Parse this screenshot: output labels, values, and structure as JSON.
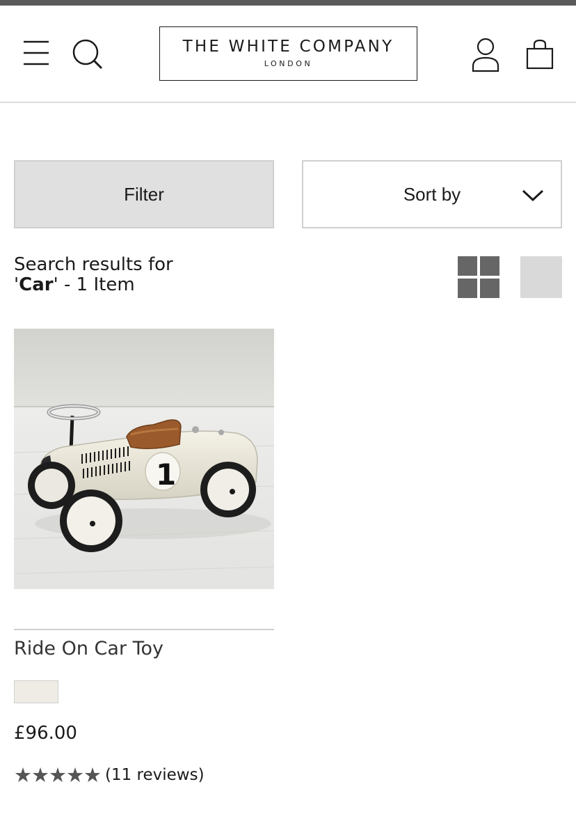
{
  "header": {
    "logo_main": "THE WHITE COMPANY",
    "logo_sub": "LONDON",
    "icons": [
      "menu-icon",
      "search-icon",
      "account-icon",
      "shopping-bag-icon"
    ]
  },
  "controls": {
    "filter_label": "Filter",
    "sort_label": "Sort by"
  },
  "results": {
    "prefix": "Search results for",
    "query": "Car",
    "suffix": " - 1 Item"
  },
  "view_toggle": {
    "options": [
      "grid-view",
      "list-view"
    ],
    "selected": "grid-view"
  },
  "products": [
    {
      "name": "Ride On Car Toy",
      "swatch_color": "#efece6",
      "price": "£96.00",
      "stars": "★★★★★",
      "rating": 5,
      "reviews": "(11 reviews)"
    }
  ],
  "colors": {
    "top_strip": "#5b5b5b",
    "filter_bg": "#e0e0e0",
    "view_icon": "#666666",
    "border": "#cfcfcf"
  }
}
